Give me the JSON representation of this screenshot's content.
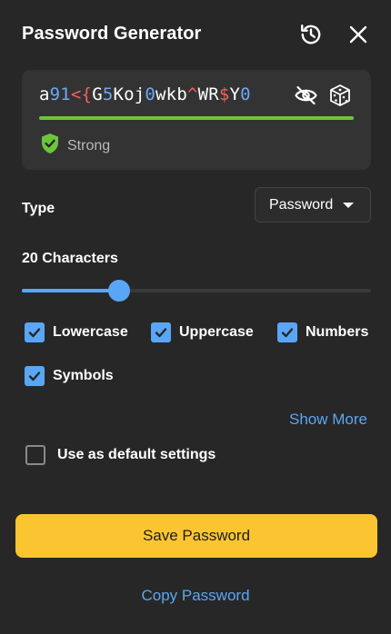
{
  "header": {
    "title": "Password Generator",
    "history_icon": "history-icon",
    "close_icon": "close-icon"
  },
  "password": {
    "segments": [
      {
        "t": "a",
        "k": "l"
      },
      {
        "t": "91",
        "k": "n"
      },
      {
        "t": "<{",
        "k": "s"
      },
      {
        "t": "G",
        "k": "l"
      },
      {
        "t": "5",
        "k": "n"
      },
      {
        "t": "Koj",
        "k": "l"
      },
      {
        "t": "0",
        "k": "n"
      },
      {
        "t": "wkb",
        "k": "l"
      },
      {
        "t": "^",
        "k": "s"
      },
      {
        "t": "WR",
        "k": "l"
      },
      {
        "t": "$",
        "k": "s"
      },
      {
        "t": "Y",
        "k": "l"
      },
      {
        "t": "0",
        "k": "n"
      }
    ],
    "visibility_icon": "eye-off-icon",
    "regenerate_icon": "dice-icon",
    "strength": {
      "label": "Strong",
      "color": "#6bc63a",
      "icon": "shield-check-icon"
    }
  },
  "type": {
    "label": "Type",
    "selected": "Password"
  },
  "length": {
    "label": "20 Characters",
    "fraction": 0.155
  },
  "options": {
    "lowercase": {
      "label": "Lowercase",
      "checked": true
    },
    "uppercase": {
      "label": "Uppercase",
      "checked": true
    },
    "numbers": {
      "label": "Numbers",
      "checked": true
    },
    "symbols": {
      "label": "Symbols",
      "checked": true
    }
  },
  "show_more": "Show More",
  "default_settings": {
    "label": "Use as default settings",
    "checked": false
  },
  "actions": {
    "save": "Save Password",
    "copy": "Copy Password"
  },
  "colors": {
    "accent": "#5aa6f6",
    "primary_button": "#fbc531",
    "background": "#272727",
    "number": "#6aa9f3",
    "symbol": "#f3605c"
  }
}
